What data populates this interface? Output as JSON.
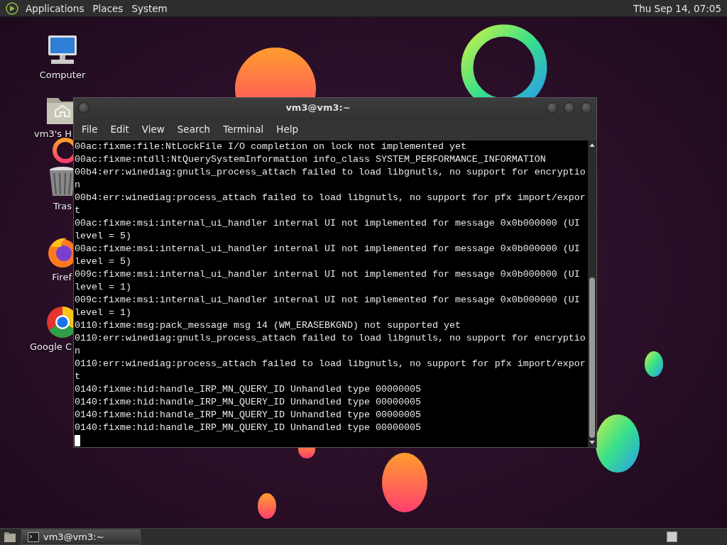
{
  "top_panel": {
    "menus": [
      "Applications",
      "Places",
      "System"
    ],
    "clock": "Thu Sep 14, 07:05"
  },
  "desktop_icons": [
    {
      "kind": "computer",
      "label": "Computer"
    },
    {
      "kind": "home",
      "label": "vm3's H"
    },
    {
      "kind": "trash",
      "label": "Tras"
    },
    {
      "kind": "firefox",
      "label": "Firef"
    },
    {
      "kind": "chrome",
      "label": "Google C"
    }
  ],
  "terminal": {
    "title": "vm3@vm3:~",
    "menu": [
      "File",
      "Edit",
      "View",
      "Search",
      "Terminal",
      "Help"
    ],
    "lines": [
      "00ac:fixme:file:NtLockFile I/O completion on lock not implemented yet",
      "00ac:fixme:ntdll:NtQuerySystemInformation info_class SYSTEM_PERFORMANCE_INFORMATION",
      "00b4:err:winediag:gnutls_process_attach failed to load libgnutls, no support for encryptio",
      "n",
      "00b4:err:winediag:process_attach failed to load libgnutls, no support for pfx import/expor",
      "t",
      "00ac:fixme:msi:internal_ui_handler internal UI not implemented for message 0x0b000000 (UI",
      "level = 5)",
      "00ac:fixme:msi:internal_ui_handler internal UI not implemented for message 0x0b000000 (UI",
      "level = 5)",
      "009c:fixme:msi:internal_ui_handler internal UI not implemented for message 0x0b000000 (UI",
      "level = 1)",
      "009c:fixme:msi:internal_ui_handler internal UI not implemented for message 0x0b000000 (UI",
      "level = 1)",
      "0110:fixme:msg:pack_message msg 14 (WM_ERASEBKGND) not supported yet",
      "0110:err:winediag:gnutls_process_attach failed to load libgnutls, no support for encryptio",
      "n",
      "0110:err:winediag:process_attach failed to load libgnutls, no support for pfx import/expor",
      "t",
      "0140:fixme:hid:handle_IRP_MN_QUERY_ID Unhandled type 00000005",
      "0140:fixme:hid:handle_IRP_MN_QUERY_ID Unhandled type 00000005",
      "0140:fixme:hid:handle_IRP_MN_QUERY_ID Unhandled type 00000005",
      "0140:fixme:hid:handle_IRP_MN_QUERY_ID Unhandled type 00000005"
    ]
  },
  "taskbar": {
    "tasks": [
      {
        "label": "vm3@vm3:~",
        "selected": true
      }
    ]
  }
}
